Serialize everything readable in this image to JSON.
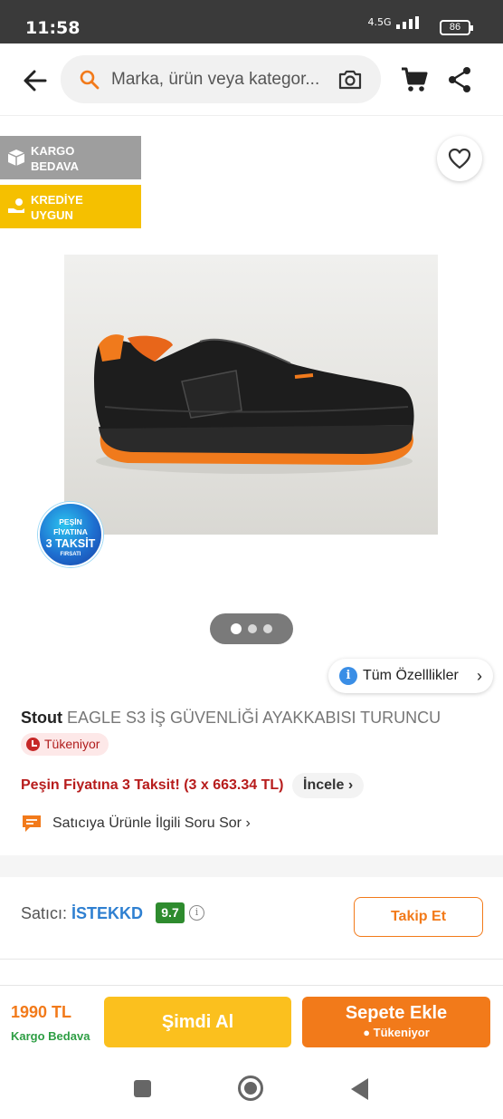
{
  "status_bar": {
    "time": "11:58",
    "network": "4.5G",
    "battery": "86"
  },
  "header": {
    "search_placeholder": "Marka, ürün veya kategor...",
    "icons": [
      "back-arrow-icon",
      "search-icon",
      "camera-icon",
      "cart-icon",
      "share-icon"
    ]
  },
  "badges": [
    {
      "label": "KARGO BEDAVA",
      "line1": "KARGO",
      "line2": "BEDAVA",
      "color": "#9e9e9e"
    },
    {
      "label": "KREDİYE UYGUN",
      "line1": "KREDİYE",
      "line2": "UYGUN",
      "color": "#f5c000"
    }
  ],
  "promo_sticker": {
    "line1": "PEŞİN",
    "line2": "FİYATINA",
    "line3": "3 TAKSİT",
    "line4": "FIRSATI"
  },
  "gallery": {
    "current": 1,
    "total": 3
  },
  "all_features_label": "Tüm Özelllikler",
  "product": {
    "brand": "Stout",
    "name": "EAGLE S3 İŞ GÜVENLİĞİ AYAKKABISI TURUNCU",
    "stock_badge": "Tükeniyor"
  },
  "installment": {
    "text": "Peşin Fiyatına 3 Taksit! (3 x 663.34 TL)",
    "link": "İncele"
  },
  "question_link": "Satıcıya Ürünle İlgili Soru Sor",
  "seller": {
    "label": "Satıcı:",
    "name": "İSTEKKD",
    "score": "9.7",
    "follow_label": "Takip Et"
  },
  "bottom": {
    "price": "1990 TL",
    "shipping": "Kargo Bedava",
    "buy_now": "Şimdi Al",
    "add_to_cart": "Sepete Ekle",
    "add_to_cart_sub": "Tükeniyor"
  },
  "colors": {
    "accent": "#f27a1a",
    "buy_now": "#fbc01e",
    "shipping": "#2e9e44",
    "seller": "#2f80d1",
    "score": "#2e8b2e"
  }
}
